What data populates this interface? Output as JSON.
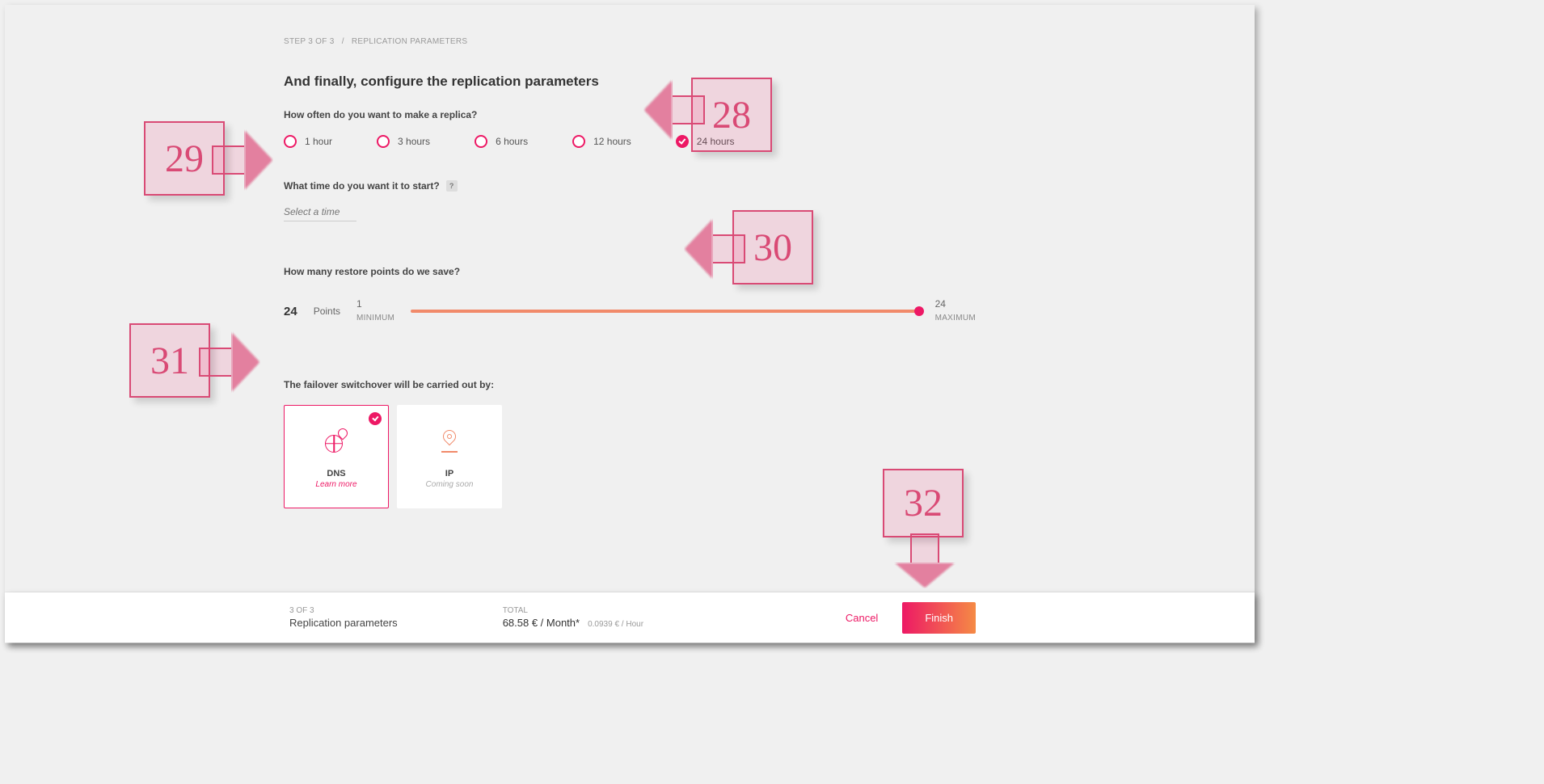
{
  "breadcrumb": {
    "step": "STEP 3 OF 3",
    "page": "REPLICATION PARAMETERS"
  },
  "title": "And finally, configure the replication parameters",
  "frequency": {
    "label": "How often do you want to make a replica?",
    "options": [
      {
        "label": "1 hour",
        "checked": false
      },
      {
        "label": "3 hours",
        "checked": false
      },
      {
        "label": "6 hours",
        "checked": false
      },
      {
        "label": "12 hours",
        "checked": false
      },
      {
        "label": "24 hours",
        "checked": true
      }
    ]
  },
  "start_time": {
    "label": "What time do you want it to start?",
    "placeholder": "Select a time",
    "help": "?"
  },
  "restore": {
    "label": "How many restore points do we save?",
    "value": "24",
    "unit": "Points",
    "min_val": "1",
    "min_label": "MINIMUM",
    "max_val": "24",
    "max_label": "MAXIMUM"
  },
  "failover": {
    "label": "The failover switchover will be carried out by:",
    "cards": [
      {
        "title": "DNS",
        "sub": "Learn more",
        "selected": true
      },
      {
        "title": "IP",
        "sub": "Coming soon",
        "selected": false
      }
    ]
  },
  "footer": {
    "step_tiny": "3 OF 3",
    "step_val": "Replication parameters",
    "total_tiny": "TOTAL",
    "price_main": "68.58 € / Month*",
    "price_sub": "0.0939 € / Hour",
    "cancel": "Cancel",
    "finish": "Finish"
  },
  "annotations": {
    "a28": "28",
    "a29": "29",
    "a30": "30",
    "a31": "31",
    "a32": "32"
  }
}
